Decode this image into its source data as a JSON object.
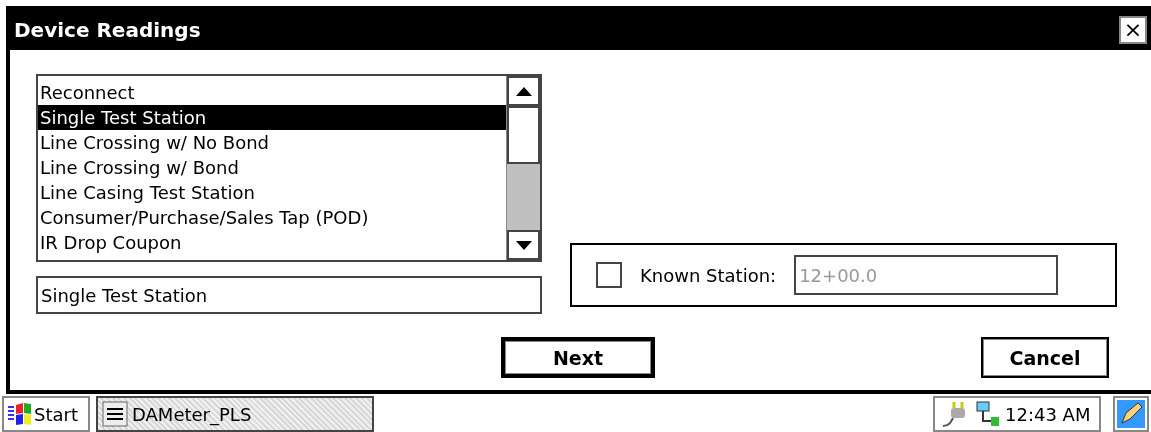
{
  "window": {
    "title": "Device Readings",
    "close": "×"
  },
  "list": {
    "items": [
      {
        "label": "Reconnect",
        "selected": false
      },
      {
        "label": "Single Test Station",
        "selected": true
      },
      {
        "label": "Line Crossing w/ No Bond",
        "selected": false
      },
      {
        "label": "Line Crossing w/ Bond",
        "selected": false
      },
      {
        "label": "Line Casing Test Station",
        "selected": false
      },
      {
        "label": "Consumer/Purchase/Sales Tap (POD)",
        "selected": false
      },
      {
        "label": "IR Drop Coupon",
        "selected": false
      }
    ]
  },
  "selection_field": {
    "value": "Single Test Station"
  },
  "known_station": {
    "label": "Known Station:",
    "checked": false,
    "placeholder": "12+00.0"
  },
  "buttons": [
    {
      "label": "Next",
      "default": true
    },
    {
      "label": "Cancel",
      "default": false
    }
  ],
  "taskbar": {
    "start": "Start",
    "app": "DAMeter_PLS",
    "clock": "12:43 AM"
  }
}
